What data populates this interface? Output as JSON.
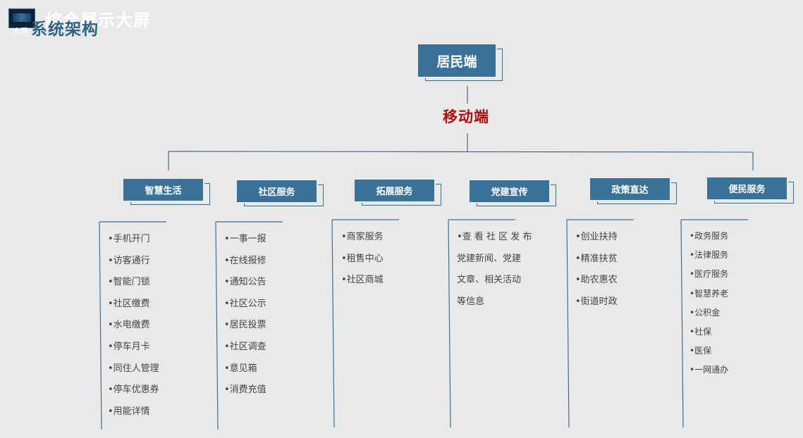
{
  "header": {
    "overlay_title": "综合展示大屏",
    "thumb_label": "大屏",
    "title": "系统架构"
  },
  "root": {
    "label": "居民端"
  },
  "sub": {
    "label": "移动端"
  },
  "categories": [
    {
      "label": "智慧生活",
      "items": [
        "•手机开门",
        "•访客通行",
        "•智能门锁",
        "•社区缴费",
        "•水电缴费",
        "•停车月卡",
        "•同住人管理",
        "•停车优惠券",
        "•用能详情"
      ]
    },
    {
      "label": "社区服务",
      "items": [
        "•一事一报",
        "•在线报修",
        "•通知公告",
        "•社区公示",
        "•居民投票",
        "•社区调查",
        "•意见箱",
        "•消费充值"
      ]
    },
    {
      "label": "拓展服务",
      "items": [
        "•商家服务",
        "•租售中心",
        "•社区商城"
      ]
    },
    {
      "label": "党建宣传",
      "items": [
        "•查 看 社 区 发 布",
        "党建新闻、党建",
        "文章、相关活动",
        "等信息"
      ]
    },
    {
      "label": "政策直达",
      "items": [
        "•创业扶持",
        "•精准扶贫",
        "•助农惠农",
        "•街道时政"
      ]
    },
    {
      "label": "便民服务",
      "items": [
        "•政务服务",
        "•法律服务",
        "•医疗服务",
        "•智慧养老",
        "•公积金",
        "•社保",
        "•医保",
        "•一网通办"
      ]
    }
  ],
  "colors": {
    "box": "#3a7196",
    "line": "#3b6e93",
    "accent": "#a80f0f",
    "title": "#2d6383",
    "background": "#e9e9e9"
  }
}
